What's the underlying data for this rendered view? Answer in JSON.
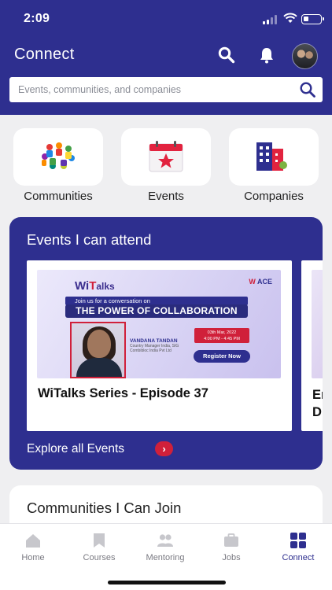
{
  "status_bar": {
    "time": "2:09"
  },
  "header": {
    "title": "Connect",
    "search_icon": "search-icon",
    "notification_icon": "bell-icon",
    "search_placeholder": "Events, communities, and companies"
  },
  "categories": [
    {
      "label": "Communities",
      "icon": "communities-icon"
    },
    {
      "label": "Events",
      "icon": "calendar-star-icon"
    },
    {
      "label": "Companies",
      "icon": "buildings-icon"
    }
  ],
  "events_section": {
    "title": "Events I can attend",
    "events": [
      {
        "name": "WiTalks Series - Episode 37",
        "thumbnail": {
          "logo_wi": "Wi",
          "logo_t": "T",
          "logo_rest": "alks",
          "ace_logo_w": "W",
          "ace_logo_rest": "ACE",
          "tagline": "Join us for a conversation on",
          "headline": "THE POWER OF COLLABORATION",
          "speaker_name": "VANDANA TANDAN",
          "speaker_role": "Country Manager India, SIG Combibloc India Pvt Ltd",
          "date": "03th Mar, 2022",
          "time": "4:00 PM - 4:45 PM",
          "cta": "Register Now"
        }
      },
      {
        "name": "Em Dig"
      }
    ],
    "explore_label": "Explore all Events",
    "explore_arrow": "›"
  },
  "communities_section": {
    "title": "Communities I Can Join"
  },
  "tab_bar": {
    "tabs": [
      {
        "label": "Home",
        "icon": "home-icon",
        "active": false
      },
      {
        "label": "Courses",
        "icon": "bookmark-icon",
        "active": false
      },
      {
        "label": "Mentoring",
        "icon": "people-icon",
        "active": false
      },
      {
        "label": "Jobs",
        "icon": "briefcase-icon",
        "active": false
      },
      {
        "label": "Connect",
        "icon": "grid-icon",
        "active": true
      }
    ]
  },
  "colors": {
    "brand": "#2e2f8f",
    "accent": "#d0203a",
    "background": "#efeff1"
  }
}
